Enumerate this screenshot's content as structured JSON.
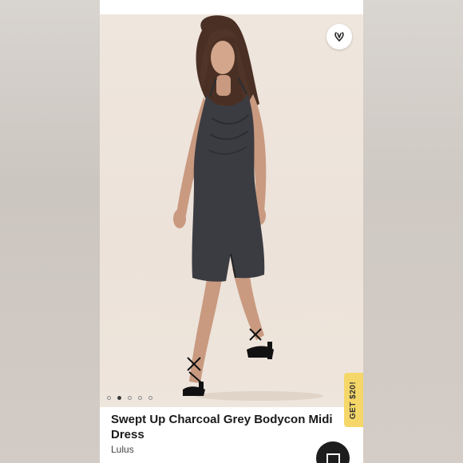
{
  "product": {
    "title": "Swept Up Charcoal Grey Bodycon Midi Dress",
    "brand": "Lulus"
  },
  "gallery": {
    "image_count": 5,
    "active_index": 1,
    "photo_subject": "model-in-charcoal-grey-dress"
  },
  "icons": {
    "like": "heart-outline-icon",
    "chat": "chat-icon"
  },
  "promo": {
    "label": "GET $20!",
    "color": "#f5d769"
  },
  "colors": {
    "dress": "#3b3c42",
    "backdrop": "#ece2d9",
    "chat_button": "#1d1d1d"
  }
}
